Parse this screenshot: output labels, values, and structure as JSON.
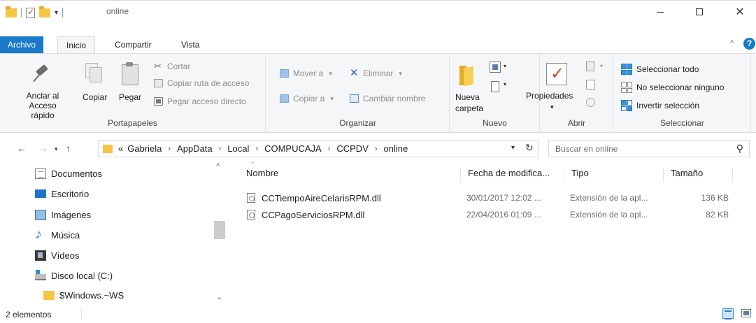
{
  "window": {
    "title": "online",
    "qat_dropdown": "▾",
    "controls": {
      "minimize": "minimize",
      "maximize": "maximize",
      "close": "✕"
    }
  },
  "ribbon": {
    "tabs": [
      {
        "label": "Archivo",
        "active": false
      },
      {
        "label": "Inicio",
        "active": true
      },
      {
        "label": "Compartir",
        "active": false
      },
      {
        "label": "Vista",
        "active": false
      }
    ],
    "collapse_glyph": "^",
    "help_glyph": "?",
    "groups": {
      "portapapeles": {
        "label": "Portapapeles",
        "anclar": "Anclar al\nAcceso rápido",
        "anclar_line1": "Anclar al",
        "anclar_line2": "Acceso rápido",
        "copiar": "Copiar",
        "pegar": "Pegar",
        "cortar": "Cortar",
        "copiar_ruta": "Copiar ruta de acceso",
        "pegar_acceso": "Pegar acceso directo"
      },
      "organizar": {
        "label": "Organizar",
        "mover": "Mover a",
        "copiar_a": "Copiar a",
        "eliminar": "Eliminar",
        "cambiar_nombre": "Cambiar nombre"
      },
      "nuevo": {
        "label": "Nuevo",
        "nueva_line1": "Nueva",
        "nueva_line2": "carpeta"
      },
      "abrir": {
        "label": "Abrir",
        "propiedades": "Propiedades"
      },
      "seleccionar": {
        "label": "Seleccionar",
        "todo": "Seleccionar todo",
        "ninguno": "No seleccionar ninguno",
        "invertir": "Invertir selección"
      }
    }
  },
  "address": {
    "overflow": "«",
    "crumbs": [
      "Gabriela",
      "AppData",
      "Local",
      "COMPUCAJA",
      "CCPDV",
      "online"
    ],
    "separator": "›"
  },
  "search": {
    "placeholder": "Buscar en online"
  },
  "nav_pane": {
    "items": [
      {
        "label": "Documentos",
        "icon": "documents-icon"
      },
      {
        "label": "Escritorio",
        "icon": "desktop-icon"
      },
      {
        "label": "Imágenes",
        "icon": "pictures-icon"
      },
      {
        "label": "Música",
        "icon": "music-icon"
      },
      {
        "label": "Vídeos",
        "icon": "videos-icon"
      },
      {
        "label": "Disco local (C:)",
        "icon": "local-disk-icon"
      },
      {
        "label": "$Windows.~WS",
        "icon": "folder-icon"
      }
    ]
  },
  "file_list": {
    "columns": [
      "Nombre",
      "Fecha de modifica...",
      "Tipo",
      "Tamaño"
    ],
    "rows": [
      {
        "name": "CCTiempoAireCelarisRPM.dll",
        "date": "30/01/2017 12:02 ...",
        "type": "Extensión de la apl...",
        "size": "136 KB"
      },
      {
        "name": "CCPagoServiciosRPM.dll",
        "date": "22/04/2016 01:09 ...",
        "type": "Extensión de la apl...",
        "size": "82 KB"
      }
    ]
  },
  "status": {
    "item_count": "2 elementos"
  },
  "colors": {
    "accent": "#1979ca",
    "ribbon_bg": "#f5f6f7",
    "folder": "#f5c543"
  }
}
